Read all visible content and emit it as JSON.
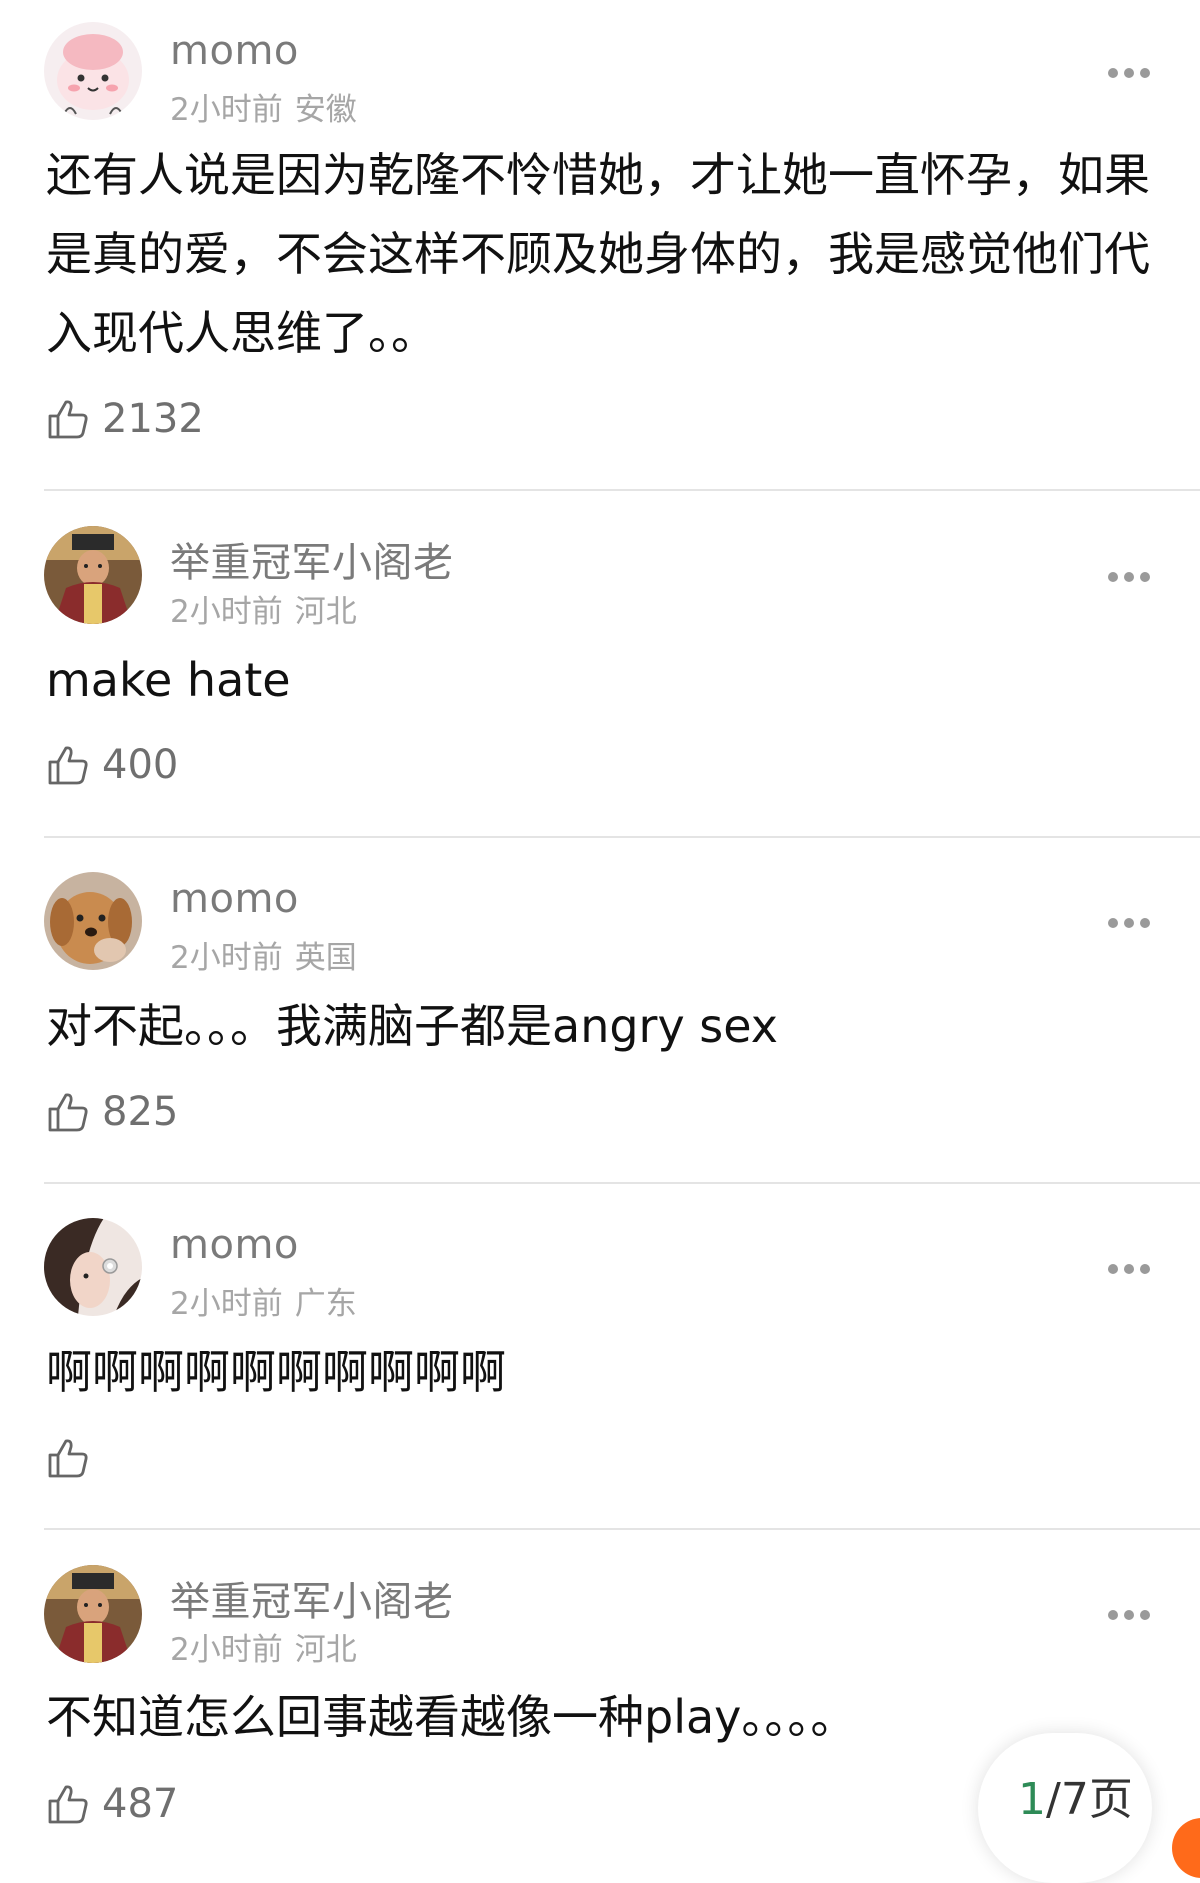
{
  "comments": [
    {
      "username": "momo",
      "time": "2小时前",
      "location": "安徽",
      "text": "还有人说是因为乾隆不怜惜她，才让她一直怀孕，如果是真的爱，不会这样不顾及她身体的，我是感觉他们代入现代人思维了。。",
      "likes": "2132",
      "avatar_icon": "pink-cartoon-avatar-icon"
    },
    {
      "username": "举重冠军小阁老",
      "time": "2小时前",
      "location": "河北",
      "text": "make hate",
      "likes": "400",
      "avatar_icon": "costume-actor-avatar-icon"
    },
    {
      "username": "momo",
      "time": "2小时前",
      "location": "英国",
      "text": "对不起。。。我满脑子都是angry sex",
      "likes": "825",
      "avatar_icon": "dog-avatar-icon"
    },
    {
      "username": "momo",
      "time": "2小时前",
      "location": "广东",
      "text": "啊啊啊啊啊啊啊啊啊啊",
      "likes": "",
      "avatar_icon": "woman-earring-avatar-icon"
    },
    {
      "username": "举重冠军小阁老",
      "time": "2小时前",
      "location": "河北",
      "text": "不知道怎么回事越看越像一种play。。。。",
      "likes": "487",
      "avatar_icon": "costume-actor-avatar-icon"
    }
  ],
  "pager": {
    "current": "1",
    "rest": "/7页"
  },
  "colors": {
    "username": "#7a7a7a",
    "meta": "#a6a6a6",
    "text": "#111111",
    "divider": "#e4e4e4",
    "accent": "#ff6a1a"
  }
}
